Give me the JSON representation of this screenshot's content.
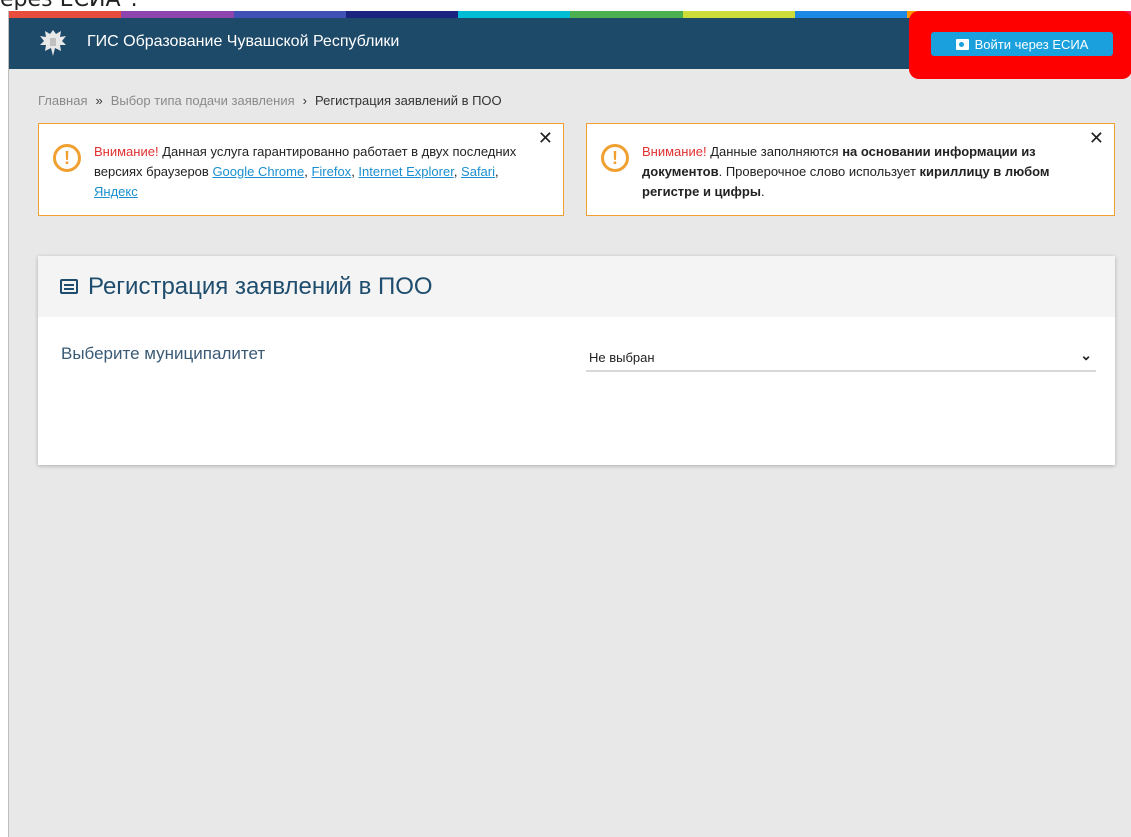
{
  "top_fragment": "ерез ЕСИА\".",
  "colors": {
    "stripe": [
      "#e74c3c",
      "#8e44ad",
      "#3f51b5",
      "#1a237e",
      "#00bcd4",
      "#4caf50",
      "#cddc39",
      "#1e88e5",
      "#ff9800",
      "#e91e63"
    ],
    "header": "#1e4a6a",
    "login_button": "#1aa0dd",
    "highlight": "#ff0000"
  },
  "header": {
    "logo": "coat-of-arms-logo",
    "title": "ГИС Образование Чувашской Республики",
    "login_label": "Войти через ЕСИА"
  },
  "breadcrumb": {
    "home": "Главная",
    "sep1": "»",
    "step": "Выбор типа подачи заявления",
    "sep2": "›",
    "current": "Регистрация заявлений в ПОО"
  },
  "alert1": {
    "label": "Внимание!",
    "text": "Данная услуга гарантированно работает в двух последних версиях браузеров",
    "links": [
      "Google Chrome",
      "Firefox",
      "Internet Explorer",
      "Safari",
      "Яндекс"
    ]
  },
  "alert2": {
    "label": "Внимание!",
    "text1": "Данные заполняются",
    "bold1": "на основании информации из документов",
    "text2": ". Проверочное слово использует",
    "bold2": "кириллицу в любом регистре и цифры",
    "text3": "."
  },
  "card": {
    "title": "Регистрация заявлений в ПОО",
    "field_label": "Выберите муниципалитет",
    "select_value": "Не выбран"
  }
}
